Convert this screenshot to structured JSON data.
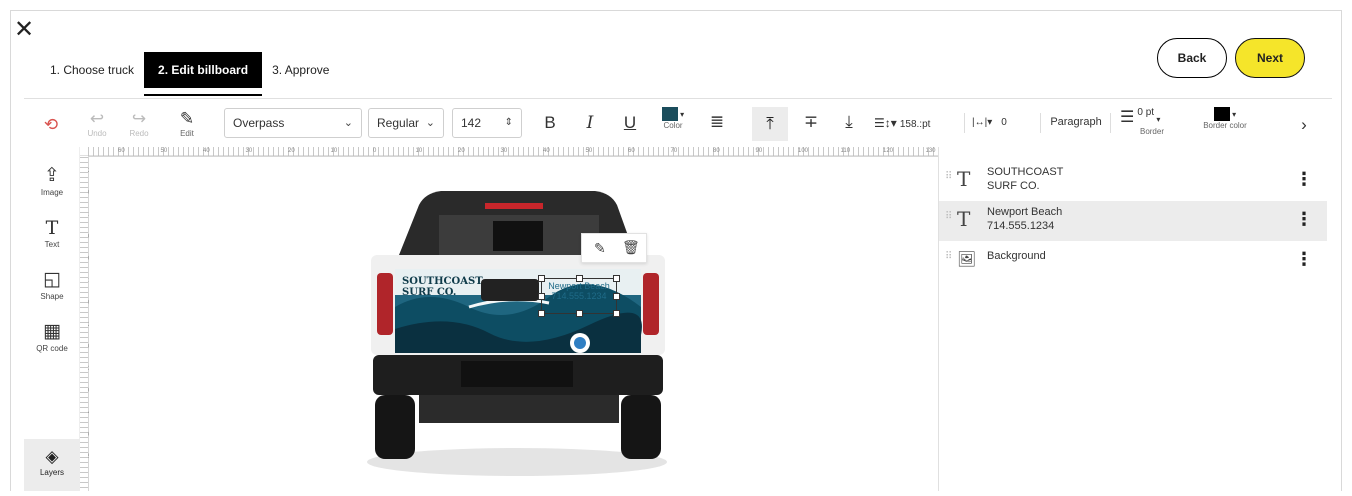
{
  "header": {
    "steps": [
      "1. Choose truck",
      "2. Edit billboard",
      "3. Approve"
    ],
    "back_label": "Back",
    "next_label": "Next",
    "accent_color": "#f5e52a"
  },
  "toolbar": {
    "undo_label": "Undo",
    "redo_label": "Redo",
    "edit_label": "Edit",
    "font_family": "Overpass",
    "font_weight": "Regular",
    "font_size": "142",
    "color_label": "Color",
    "line_height": "158.:pt",
    "letter_spacing": "0",
    "paragraph_label": "Paragraph",
    "border_width": "0 pt",
    "border_label": "Border",
    "border_color_label": "Border color",
    "text_color": "#1b4d5c"
  },
  "sidebar": {
    "items": [
      {
        "label": "Image",
        "icon": "upload-icon"
      },
      {
        "label": "Text",
        "icon": "text-icon"
      },
      {
        "label": "Shape",
        "icon": "shape-icon"
      },
      {
        "label": "QR code",
        "icon": "qr-code-icon"
      }
    ],
    "layers_label": "Layers"
  },
  "billboard": {
    "brand_line1": "SOUTHCOAST",
    "brand_line2": "SURF CO.",
    "city": "Newport Beach",
    "phone": "714.555.1234"
  },
  "layers": [
    {
      "line1": "SOUTHCOAST",
      "line2": "SURF CO.",
      "type": "text",
      "selected": false
    },
    {
      "line1": "Newport Beach",
      "line2": "714.555.1234",
      "type": "text",
      "selected": true
    },
    {
      "line1": "Background",
      "line2": "",
      "type": "image",
      "selected": false
    }
  ],
  "rulers": {
    "top": [
      "60",
      "50",
      "40",
      "30",
      "20",
      "10",
      "0",
      "10",
      "20",
      "30",
      "40",
      "50",
      "60",
      "70",
      "80",
      "90",
      "100",
      "110",
      "120",
      "130"
    ],
    "left": [
      "2",
      "0",
      "1",
      "0",
      "0",
      "1",
      "0",
      "2",
      "0",
      "3",
      "0",
      "4",
      "0",
      "5"
    ]
  }
}
